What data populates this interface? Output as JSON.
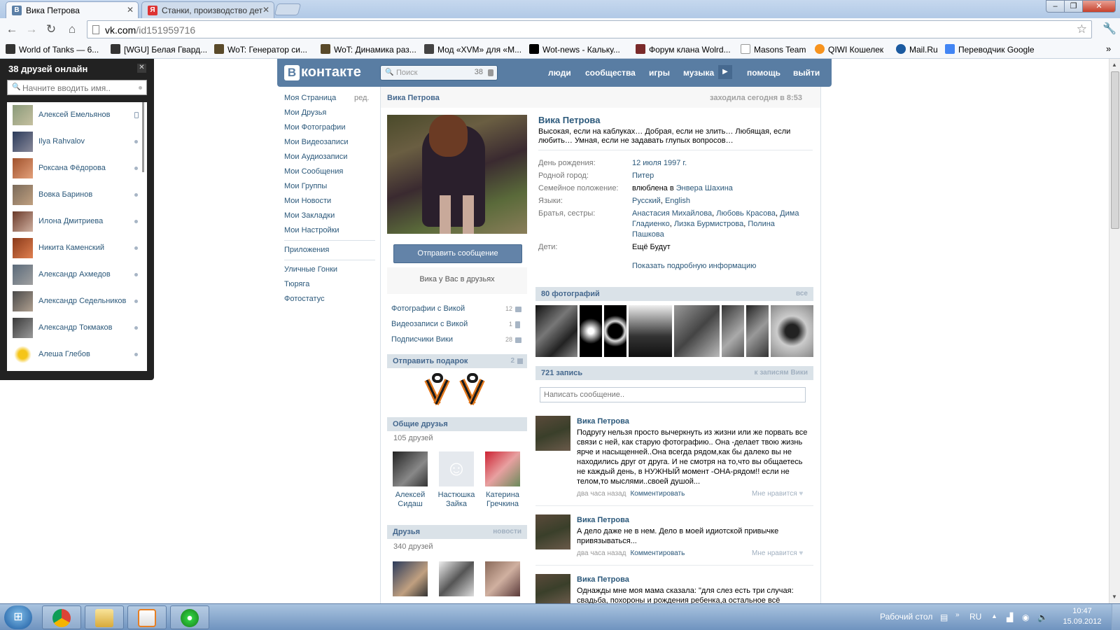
{
  "browser": {
    "tabs": [
      {
        "title": "Вика Петрова",
        "active": true
      },
      {
        "title": "Станки, производство дет",
        "active": false
      }
    ],
    "url_host": "vk.com",
    "url_path": "/id151959716",
    "bookmarks": [
      "World of Tanks — 6...",
      "[WGU] Белая Гвард...",
      "WoT: Генератор си...",
      "WoT: Динамика раз...",
      "Мод «XVM» для «M...",
      "Wot-news - Кальку...",
      "Форум клана Wolrd...",
      "Masons Team",
      "QIWI Кошелек",
      "Mail.Ru",
      "Переводчик Google"
    ],
    "bookmarks_more": "»"
  },
  "friends_online": {
    "title": "38 друзей онлайн",
    "search_placeholder": "Начните вводить имя..",
    "items": [
      {
        "name": "Алексей Емельянов",
        "mobile": true
      },
      {
        "name": "Ilya Rahvalov",
        "mobile": false
      },
      {
        "name": "Роксана Фёдорова",
        "mobile": false
      },
      {
        "name": "Вовка Баринов",
        "mobile": false
      },
      {
        "name": "Илона Дмитриева",
        "mobile": false
      },
      {
        "name": "Никита Каменский",
        "mobile": false
      },
      {
        "name": "Александр Ахмедов",
        "mobile": false
      },
      {
        "name": "Александр Седельников",
        "mobile": false
      },
      {
        "name": "Александр Токмаков",
        "mobile": false
      },
      {
        "name": "Алеша Глебов",
        "mobile": false
      }
    ]
  },
  "vk": {
    "logo": "контакте",
    "logo_letter": "В",
    "search_placeholder": "Поиск",
    "search_count": "38",
    "nav": [
      "люди",
      "сообщества",
      "игры",
      "музыка",
      "помощь",
      "выйти"
    ],
    "menu": [
      "Моя Страница",
      "Мои Друзья",
      "Мои Фотографии",
      "Мои Видеозаписи",
      "Мои Аудиозаписи",
      "Мои Сообщения",
      "Мои Группы",
      "Мои Новости",
      "Мои Закладки",
      "Мои Настройки"
    ],
    "menu_edit": "ред.",
    "apps_label": "Приложения",
    "apps": [
      "Уличные Гонки",
      "Тюряга",
      "Фотостатус"
    ]
  },
  "profile": {
    "name": "Вика Петрова",
    "last_seen": "заходила сегодня в 8:53",
    "status": "Высокая, если на каблуках… Добрая, если не злить… Любящая, если любить… Умная, если не задавать глупых вопросов…",
    "send_message": "Отправить сообщение",
    "in_friends": "Вика у Вас в друзьях",
    "counters": [
      {
        "label": "Фотографии с Викой",
        "count": "12"
      },
      {
        "label": "Видеозаписи с Викой",
        "count": "1"
      },
      {
        "label": "Подписчики Вики",
        "count": "28"
      }
    ],
    "gift_title": "Отправить подарок",
    "gift_count": "2",
    "common_title": "Общие друзья",
    "common_count": "105 друзей",
    "common_friends": [
      {
        "first": "Алексей",
        "last": "Сидаш"
      },
      {
        "first": "Настюшка",
        "last": "Зайка"
      },
      {
        "first": "Катерина",
        "last": "Гречкина"
      }
    ],
    "friends_title": "Друзья",
    "friends_link": "новости",
    "friends_count": "340 друзей",
    "info": {
      "birthday_label": "День рождения:",
      "birthday": "12 июля 1997 г.",
      "city_label": "Родной город:",
      "city": "Питер",
      "family_label": "Семейное положение:",
      "family_prefix": "влюблена в",
      "family_partner": "Энвера Шахина",
      "lang_label": "Языки:",
      "lang1": "Русский",
      "lang2": "English",
      "siblings_label": "Братья, сестры:",
      "siblings": [
        "Анастасия Михайлова",
        "Любовь Красова",
        "Дима Гладиенко",
        "Лизка Бурмистрова",
        "Полина Пашкова"
      ],
      "kids_label": "Дети:",
      "kids": "Ещё Будут",
      "more": "Показать подробную информацию"
    },
    "photos_title": "80 фотографий",
    "photos_all": "все",
    "wall_title": "721 запись",
    "wall_link": "к записям Вики",
    "wall_placeholder": "Написать сообщение..",
    "posts": [
      {
        "author": "Вика Петрова",
        "text": "Подругу нельзя просто вычеркнуть из жизни или же порвать все связи с ней, как старую фотографию.. Она -делает твою жизнь ярче и насыщенней..Она всегда рядом,как бы далеко вы не находились друг от друга. И не смотря на то,что вы общаетесь не каждый день, в НУЖНЫЙ момент -ОНА-рядом!! если не телом,то мыслями..своей душой...",
        "time": "два часа назад",
        "comment": "Комментировать",
        "like": "Мне нравится"
      },
      {
        "author": "Вика Петрова",
        "text": "А дело даже не в нем. Дело в моей идиотской привычке привязываться...",
        "time": "два часа назад",
        "comment": "Комментировать",
        "like": "Мне нравится"
      },
      {
        "author": "Вика Петрова",
        "text": "Однажды мне моя мама сказала: \"для слез есть три случая: свадьба, похороны и рождения ребенка,а остальное всё",
        "time": "",
        "comment": "",
        "like": ""
      }
    ]
  },
  "taskbar": {
    "desktop_label": "Рабочий стол",
    "lang": "RU",
    "time": "10:47",
    "date": "15.09.2012"
  },
  "colors": {
    "vk_blue": "#597da3",
    "link": "#2b587a",
    "section_head": "#dae2e8"
  }
}
